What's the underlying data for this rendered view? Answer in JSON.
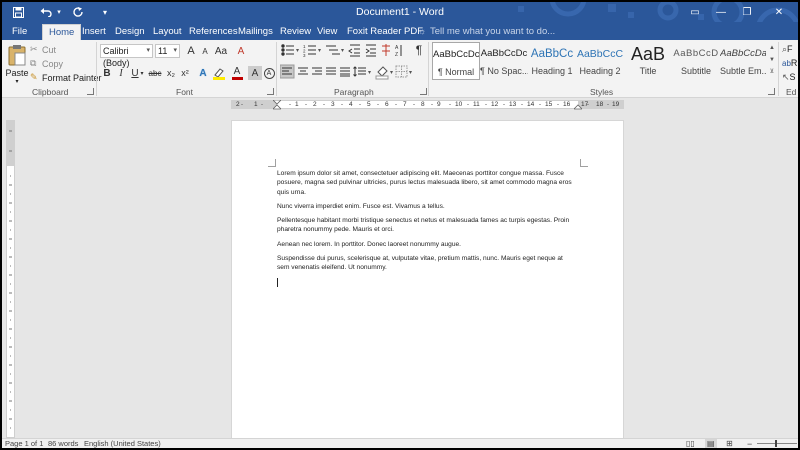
{
  "app": {
    "title": "Document1 - Word"
  },
  "quick_access": {
    "save_icon": "save-icon",
    "undo_icon": "undo-icon",
    "redo_icon": "redo-icon"
  },
  "window_controls": {
    "ribbon_options": "▭",
    "minimize": "—",
    "restore": "❐",
    "close": "✕"
  },
  "tabs": [
    {
      "label": "File"
    },
    {
      "label": "Home"
    },
    {
      "label": "Insert"
    },
    {
      "label": "Design"
    },
    {
      "label": "Layout"
    },
    {
      "label": "References"
    },
    {
      "label": "Mailings"
    },
    {
      "label": "Review"
    },
    {
      "label": "View"
    },
    {
      "label": "Foxit Reader PDF"
    }
  ],
  "tell_me": {
    "placeholder": "Tell me what you want to do..."
  },
  "clipboard": {
    "paste_label": "Paste",
    "cut_label": "Cut",
    "copy_label": "Copy",
    "format_painter_label": "Format Painter",
    "group_label": "Clipboard"
  },
  "font": {
    "font_name": "Calibri (Body)",
    "font_size": "11",
    "group_label": "Font",
    "bold": "B",
    "italic": "I",
    "underline": "U",
    "strikethrough": "abc",
    "subscript": "x₂",
    "superscript": "x²",
    "grow": "A",
    "shrink": "A",
    "case": "Aa",
    "clear": "A",
    "text_effects": "A",
    "font_color": "A",
    "char_shading": "A"
  },
  "paragraph": {
    "group_label": "Paragraph",
    "pilcrow": "¶"
  },
  "styles": {
    "group_label": "Styles",
    "items": [
      {
        "preview": "AaBbCcDc",
        "name": "¶ Normal"
      },
      {
        "preview": "AaBbCcDc",
        "name": "¶ No Spac..."
      },
      {
        "preview": "AaBbCc",
        "name": "Heading 1"
      },
      {
        "preview": "AaBbCcC",
        "name": "Heading 2"
      },
      {
        "preview": "AaB",
        "name": "Title"
      },
      {
        "preview": "AaBbCcD",
        "name": "Subtitle"
      },
      {
        "preview": "AaBbCcDa",
        "name": "Subtle Em..."
      }
    ]
  },
  "editing": {
    "group_label": "Ed",
    "find_label": "F",
    "replace_label": "R",
    "select_label": "S"
  },
  "document": {
    "paragraphs": [
      "Lorem ipsum dolor sit amet, consectetuer adipiscing elit. Maecenas porttitor congue massa. Fusce posuere, magna sed pulvinar ultricies, purus lectus malesuada libero, sit amet commodo magna eros quis urna.",
      "Nunc viverra imperdiet enim. Fusce est. Vivamus a tellus.",
      "Pellentesque habitant morbi tristique senectus et netus et malesuada fames ac turpis egestas. Proin pharetra nonummy pede. Mauris et orci.",
      "Aenean nec lorem. In porttitor. Donec laoreet nonummy augue.",
      "Suspendisse dui purus, scelerisque at, vulputate vitae, pretium mattis, nunc. Mauris eget neque at sem venenatis eleifend. Ut nonummy."
    ]
  },
  "ruler": {
    "labels": [
      "2",
      "1",
      "1",
      "2",
      "3",
      "4",
      "5",
      "6",
      "7",
      "8",
      "9",
      "10",
      "11",
      "12",
      "13",
      "14",
      "15",
      "16",
      "17",
      "18",
      "19"
    ]
  },
  "status": {
    "page": "Page 1 of 1",
    "words": "86 words",
    "language": "English (United States)"
  }
}
